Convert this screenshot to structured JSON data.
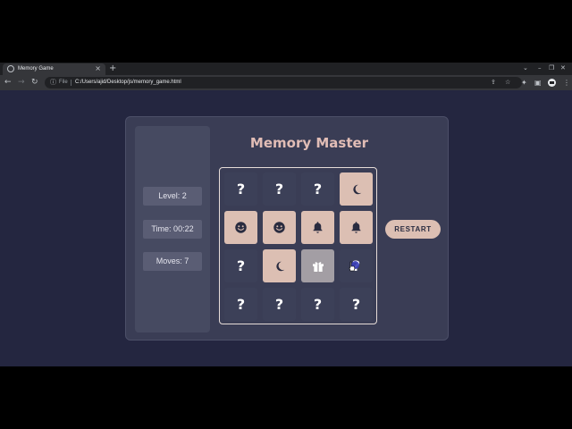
{
  "browser": {
    "tab_title": "Memory Game",
    "tab_close": "×",
    "new_tab": "+",
    "window_controls": [
      "⌄",
      "–",
      "❐",
      "✕"
    ],
    "omnibox": {
      "info_icon": "info-icon",
      "scheme_label": "File",
      "url": "C:/Users/ajid/Desktop/js/memory_game.html"
    }
  },
  "game": {
    "title": "Memory Master",
    "stats": {
      "level": "Level: 2",
      "time": "Time: 00:22",
      "moves": "Moves: 7"
    },
    "restart_label": "RESTART",
    "cards": [
      {
        "row": 0,
        "col": 0,
        "state": "hidden",
        "label": "?"
      },
      {
        "row": 0,
        "col": 1,
        "state": "hidden",
        "label": "?"
      },
      {
        "row": 0,
        "col": 2,
        "state": "hidden",
        "label": "?"
      },
      {
        "row": 0,
        "col": 3,
        "state": "revealed",
        "icon": "moon-icon"
      },
      {
        "row": 1,
        "col": 0,
        "state": "revealed",
        "icon": "smiley-icon"
      },
      {
        "row": 1,
        "col": 1,
        "state": "revealed",
        "icon": "smiley-icon"
      },
      {
        "row": 1,
        "col": 2,
        "state": "revealed",
        "icon": "bell-icon"
      },
      {
        "row": 1,
        "col": 3,
        "state": "revealed",
        "icon": "bell-icon"
      },
      {
        "row": 2,
        "col": 0,
        "state": "hidden",
        "label": "?"
      },
      {
        "row": 2,
        "col": 1,
        "state": "revealed",
        "icon": "moon-icon"
      },
      {
        "row": 2,
        "col": 2,
        "state": "selected",
        "icon": "gift-icon"
      },
      {
        "row": 2,
        "col": 3,
        "state": "hidden",
        "label": "?"
      },
      {
        "row": 3,
        "col": 0,
        "state": "hidden",
        "label": "?"
      },
      {
        "row": 3,
        "col": 1,
        "state": "hidden",
        "label": "?"
      },
      {
        "row": 3,
        "col": 2,
        "state": "hidden",
        "label": "?"
      },
      {
        "row": 3,
        "col": 3,
        "state": "hidden",
        "label": "?"
      }
    ]
  },
  "colors": {
    "page_background": "#242640",
    "card_back": "#3c4058",
    "card_face": "#dcbfb3",
    "card_selected": "#a39ea4",
    "title": "#e1bdb6",
    "icon": "#2a2c40"
  }
}
